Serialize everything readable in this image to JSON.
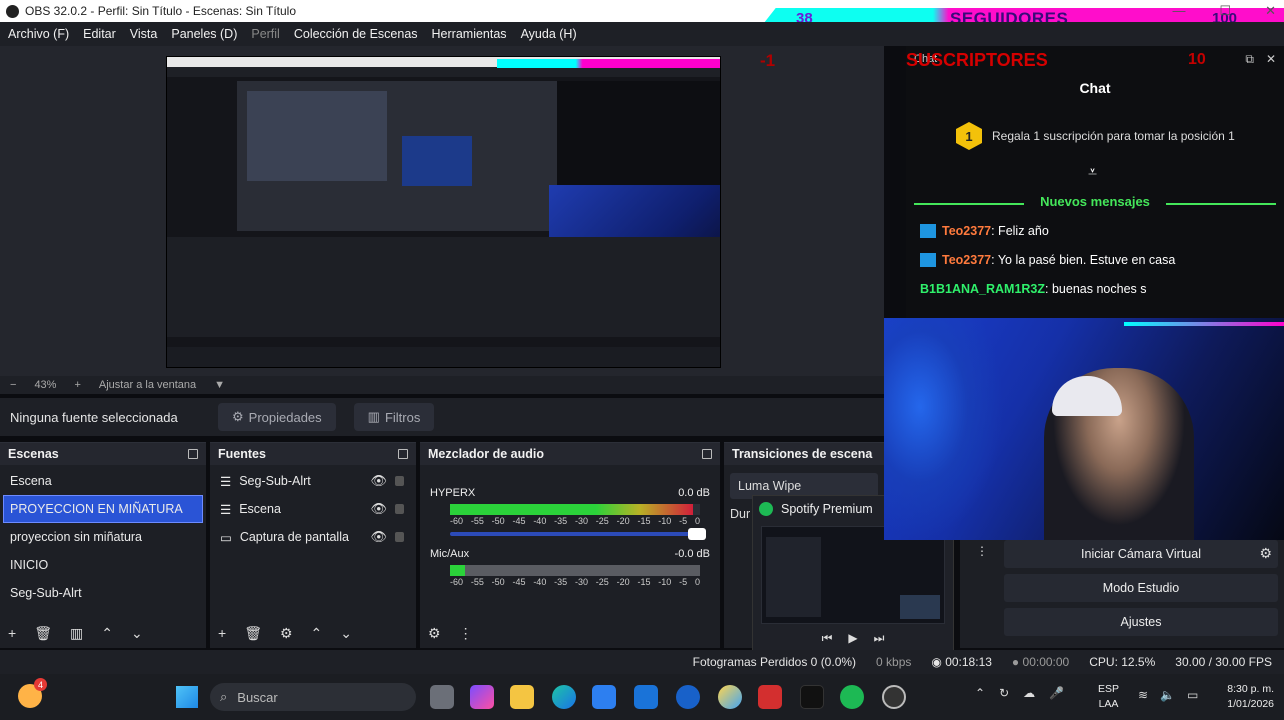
{
  "window": {
    "title": "OBS 32.0.2 - Perfil: Sin Título - Escenas: Sin Título",
    "controls": [
      "—",
      "☐",
      "✕"
    ]
  },
  "overlay": {
    "followers_count": "38",
    "followers_label": "SEGUIDORES",
    "followers_goal": "100",
    "subs_delta": "-1",
    "subs_label": "SUSCRIPTORES",
    "subs_goal": "10"
  },
  "menu": {
    "items": [
      "Archivo (F)",
      "Editar",
      "Vista",
      "Paneles (D)",
      "Perfil",
      "Colección de Escenas",
      "Herramientas",
      "Ayuda (H)"
    ]
  },
  "zoom": {
    "minus": "−",
    "value": "43%",
    "plus": "+",
    "fit_label": "Ajustar a la ventana"
  },
  "source_toolbar": {
    "no_source": "Ninguna fuente seleccionada",
    "properties": "Propiedades",
    "filters": "Filtros"
  },
  "scenes": {
    "title": "Escenas",
    "items": [
      "Escena",
      "PROYECCION EN MIÑATURA",
      "proyeccion sin miñatura",
      "INICIO",
      "Seg-Sub-Alrt"
    ],
    "selected_index": 1
  },
  "sources": {
    "title": "Fuentes",
    "items": [
      {
        "name": "Seg-Sub-Alrt",
        "icon": "list-icon"
      },
      {
        "name": "Escena",
        "icon": "list-icon"
      },
      {
        "name": "Captura de pantalla",
        "icon": "monitor-icon"
      }
    ]
  },
  "mixer": {
    "title": "Mezclador de audio",
    "tracks": [
      {
        "name": "HYPERX",
        "db": "0.0 dB",
        "level": 0.97
      },
      {
        "name": "Mic/Aux",
        "db": "-0.0 dB",
        "level": 0.06
      }
    ],
    "scale": [
      "-60",
      "-55",
      "-50",
      "-45",
      "-40",
      "-35",
      "-30",
      "-25",
      "-20",
      "-15",
      "-10",
      "-5",
      "0"
    ]
  },
  "transitions": {
    "title": "Transiciones de escena",
    "selected": "Luma Wipe",
    "duration_label": "Dur"
  },
  "spotify": {
    "title": "Spotify Premium"
  },
  "controls": {
    "virtual_cam": "Iniciar Cámara Virtual",
    "studio_mode": "Modo Estudio",
    "settings": "Ajustes"
  },
  "chat": {
    "dock_title": "Chat",
    "title": "Chat",
    "gift_badge": "1",
    "gift_text": "Regala 1 suscripción para tomar la posición 1",
    "new_messages": "Nuevos mensajes",
    "messages": [
      {
        "user": "Teo2377",
        "text": ": Feliz año",
        "color": "orange"
      },
      {
        "user": "Teo2377",
        "text": ": Yo la pasé bien. Estuve en casa",
        "color": "orange"
      },
      {
        "user": "B1B1ANA_RAM1R3Z",
        "text": ": buenas noches s",
        "color": "green"
      }
    ]
  },
  "status": {
    "dropped": "Fotogramas Perdidos 0 (0.0%)",
    "bitrate": "0 kbps",
    "rec_time": "00:18:13",
    "stream_time": "00:00:00",
    "cpu": "CPU: 12.5%",
    "fps": "30.00 / 30.00 FPS"
  },
  "taskbar": {
    "weather_badge": "4",
    "search_placeholder": "Buscar",
    "lang": "ESP",
    "lang_sub": "LAA",
    "time": "8:30 p. m.",
    "date": "1/01/2026"
  }
}
